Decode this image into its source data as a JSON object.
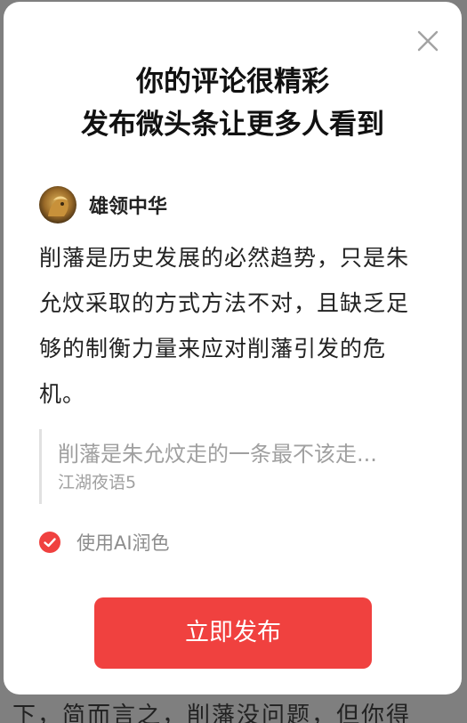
{
  "background": {
    "partial_text": "下，简而言之，削藩没问题，但你得"
  },
  "modal": {
    "title_line1": "你的评论很精彩",
    "title_line2": "发布微头条让更多人看到",
    "close_icon": "close-icon",
    "user": {
      "name": "雄领中华",
      "avatar_icon": "avatar"
    },
    "comment": "削藩是历史发展的必然趋势，只是朱允炆采取的方式方法不对，且缺乏足够的制衡力量来应对削藩引发的危机。",
    "quote": {
      "text": "削藩是朱允炆走的一条最不该走...",
      "author": "江湖夜语5"
    },
    "ai_option": {
      "label": "使用AI润色",
      "checked": true,
      "icon": "check-circle-icon"
    },
    "publish_button": "立即发布"
  },
  "colors": {
    "accent": "#f0413f",
    "muted": "#a0a0a0",
    "text": "#222222"
  }
}
